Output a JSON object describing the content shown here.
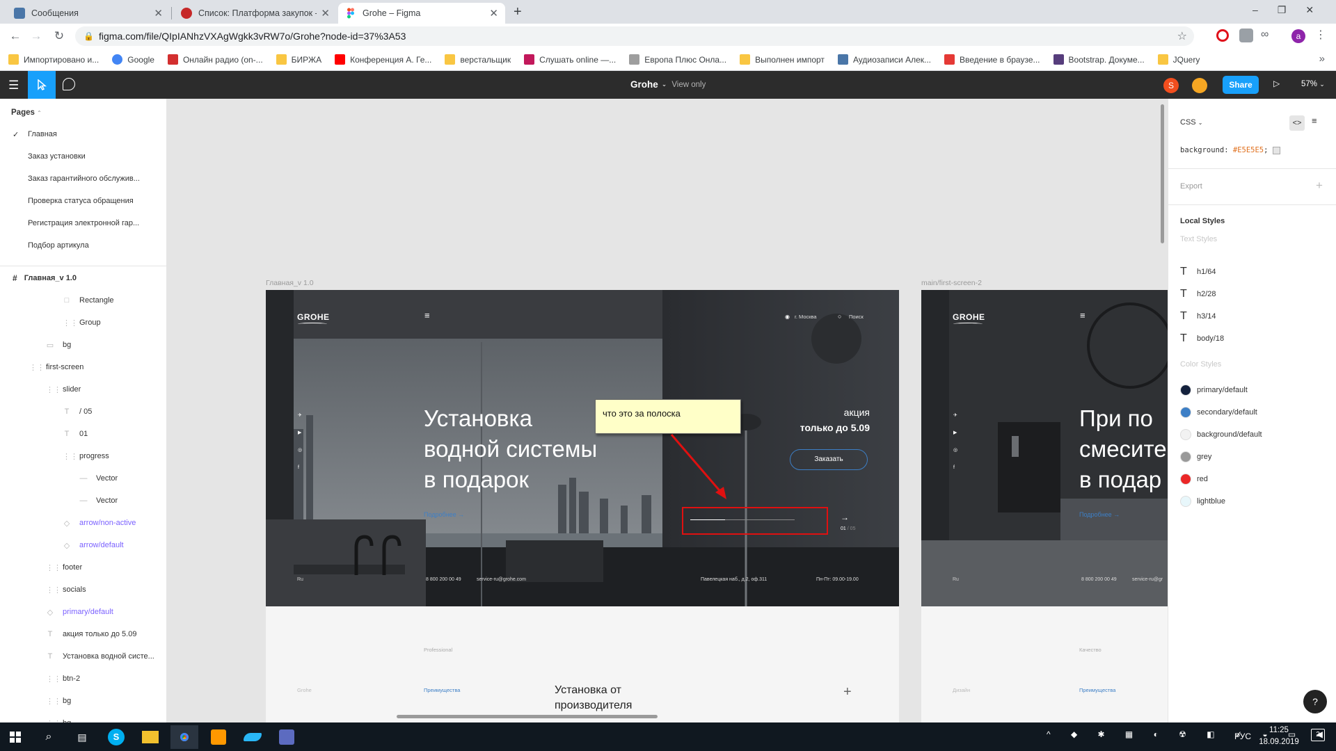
{
  "browser": {
    "tabs": [
      {
        "title": "Сообщения",
        "color": "#4a76a8"
      },
      {
        "title": "Список: Платформа закупок - E",
        "color": "#c62828"
      },
      {
        "title": "Grohe – Figma",
        "color": "#0acf83"
      }
    ],
    "new_tab": "+",
    "url": "figma.com/file/QIpIANhzVXAgWgkk3vRW7o/Grohe?node-id=37%3A53",
    "bookmarks": [
      {
        "label": "Импортировано и...",
        "color": "#f9c642"
      },
      {
        "label": "Google",
        "color": "#4285f4"
      },
      {
        "label": "Онлайн радио (on-...",
        "color": "#d32f2f"
      },
      {
        "label": "БИРЖА",
        "color": "#f9c642"
      },
      {
        "label": "Конференция А. Ге...",
        "color": "#ff0000"
      },
      {
        "label": "верстальщик",
        "color": "#f9c642"
      },
      {
        "label": "Слушать online —...",
        "color": "#c2185b"
      },
      {
        "label": "Европа Плюс Онла...",
        "color": "#9e9e9e"
      },
      {
        "label": "Выполнен импорт",
        "color": "#f9c642"
      },
      {
        "label": "Аудиозаписи Алек...",
        "color": "#4a76a8"
      },
      {
        "label": "Введение в браузе...",
        "color": "#e53935"
      },
      {
        "label": "Bootstrap. Докуме...",
        "color": "#563d7c"
      },
      {
        "label": "JQuery",
        "color": "#f9c642"
      }
    ],
    "more": "»"
  },
  "figma": {
    "file_name": "Grohe",
    "mode": "View only",
    "avatar_letter": "S",
    "share_label": "Share",
    "zoom": "57%",
    "pages_title": "Pages",
    "pages": [
      {
        "label": "Главная",
        "checked": true
      },
      {
        "label": "Заказ установки"
      },
      {
        "label": "Заказ гарантийного обслужив..."
      },
      {
        "label": "Проверка статуса обращения"
      },
      {
        "label": "Регистрация электронной гар..."
      },
      {
        "label": "Подбор артикула"
      }
    ],
    "frame_layer": "Главная_v 1.0",
    "layers": [
      {
        "label": "Rectangle",
        "icon": "□",
        "indent": 3
      },
      {
        "label": "Group",
        "icon": "⋮⋮",
        "indent": 3
      },
      {
        "label": "bg",
        "icon": "▭",
        "indent": 2
      },
      {
        "label": "first-screen",
        "icon": "⋮⋮",
        "indent": 1
      },
      {
        "label": "slider",
        "icon": "⋮⋮",
        "indent": 2
      },
      {
        "label": "/ 05",
        "icon": "T",
        "indent": 3
      },
      {
        "label": "01",
        "icon": "T",
        "indent": 3
      },
      {
        "label": "progress",
        "icon": "⋮⋮",
        "indent": 3
      },
      {
        "label": "Vector",
        "icon": "—",
        "indent": 4
      },
      {
        "label": "Vector",
        "icon": "—",
        "indent": 4
      },
      {
        "label": "arrow/non-active",
        "icon": "◇",
        "indent": 3,
        "component": true
      },
      {
        "label": "arrow/default",
        "icon": "◇",
        "indent": 3,
        "component": true
      },
      {
        "label": "footer",
        "icon": "⋮⋮",
        "indent": 2
      },
      {
        "label": "socials",
        "icon": "⋮⋮",
        "indent": 2
      },
      {
        "label": "primary/default",
        "icon": "◇",
        "indent": 2,
        "component": true
      },
      {
        "label": "акция только до 5.09",
        "icon": "T",
        "indent": 2
      },
      {
        "label": "Установка водной систе...",
        "icon": "T",
        "indent": 2
      },
      {
        "label": "btn-2",
        "icon": "⋮⋮",
        "indent": 2
      },
      {
        "label": "bg",
        "icon": "⋮⋮",
        "indent": 2
      },
      {
        "label": "bg",
        "icon": "⋮⋮",
        "indent": 2
      }
    ],
    "inspect": {
      "lang": "CSS",
      "css_prop": "background:",
      "css_value": "#E5E5E5",
      "css_end": ";",
      "export_label": "Export",
      "local_styles": "Local Styles",
      "text_styles_title": "Text Styles",
      "text_styles": [
        "h1/64",
        "h2/28",
        "h3/14",
        "body/18"
      ],
      "color_styles_title": "Color Styles",
      "color_styles": [
        {
          "name": "primary/default",
          "color": "#14213d"
        },
        {
          "name": "secondary/default",
          "color": "#3d7fc6"
        },
        {
          "name": "background/default",
          "color": "#f2f2f2"
        },
        {
          "name": "grey",
          "color": "#999999"
        },
        {
          "name": "red",
          "color": "#eb2727"
        },
        {
          "name": "lightblue",
          "color": "#e8f7fb"
        }
      ]
    },
    "frame1": {
      "label": "Главная_v 1.0",
      "logo": "GROHE",
      "city": "г. Москва",
      "search": "Поиск",
      "headline": [
        "Установка",
        "водной системы",
        "в подарок"
      ],
      "more_link": "Подробнее →",
      "promo1": "акция",
      "promo2": "только до 5.09",
      "order_button": "Заказать",
      "slide_current": "01",
      "slide_total": "/ 05",
      "arrow": "→",
      "lang": "Ru",
      "phone": "8 800 200 00 49",
      "email": "service-ru@grohe.com",
      "address": "Павелецкая наб., д.2, оф.311",
      "hours": "Пн-Пт: 09.00-19.00",
      "sec_professional": "Professional",
      "sec_grohe": "Grohe",
      "sec_benefits": "Преимущества",
      "sec_heading": [
        "Установка от",
        "производителя"
      ],
      "plus": "+"
    },
    "frame2": {
      "label": "main/first-screen-2",
      "logo": "GROHE",
      "headline": [
        "При по",
        "смесите",
        "в подар"
      ],
      "more_link": "Подробнее →",
      "lang": "Ru",
      "phone": "8 800 200 00 49",
      "email": "service-ru@gr",
      "sec_quality": "Качество",
      "sec_design": "Дизайн",
      "sec_benefits": "Преимущества"
    },
    "annotation": "что это за полоска",
    "help": "?"
  },
  "taskbar": {
    "lang": "РУС",
    "time": "11:25",
    "date": "18.09.2019",
    "notif": "2"
  }
}
